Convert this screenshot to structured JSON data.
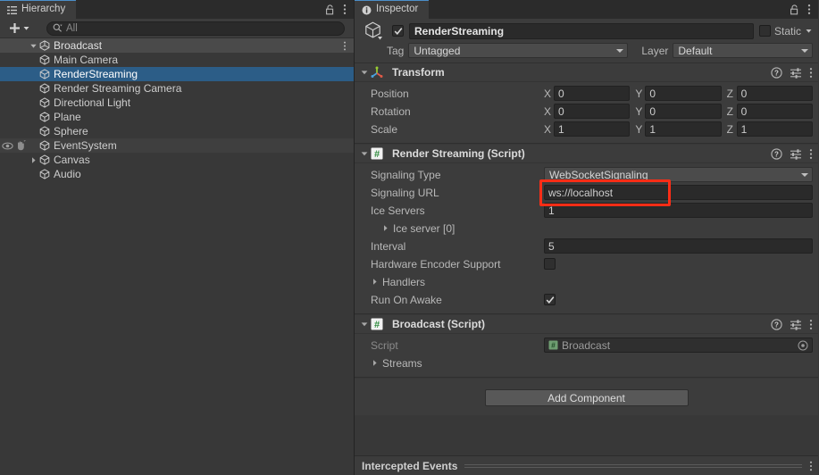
{
  "hierarchy": {
    "tab_label": "Hierarchy",
    "tab_icon": "hierarchy-icon",
    "lock_icon": "lock-open-icon",
    "menu_icon": "kebab-menu-icon",
    "toolbar": {
      "add_label": "+",
      "add_dropdown_icon": "chevron-down-icon",
      "search_icon": "search-icon",
      "search_placeholder": "All",
      "search_value": ""
    },
    "scene_name": "Broadcast",
    "scene_icon": "unity-scene-icon",
    "scene_menu_icon": "kebab-menu-icon",
    "items": [
      {
        "label": "Main Camera",
        "icon": "gameobject-cube-icon",
        "selected": false,
        "expandable": false,
        "visibility_icons": false
      },
      {
        "label": "RenderStreaming",
        "icon": "gameobject-cube-icon",
        "selected": true,
        "expandable": false,
        "visibility_icons": false
      },
      {
        "label": "Render Streaming Camera",
        "icon": "gameobject-cube-icon",
        "selected": false,
        "expandable": false,
        "visibility_icons": false
      },
      {
        "label": "Directional Light",
        "icon": "gameobject-cube-icon",
        "selected": false,
        "expandable": false,
        "visibility_icons": false
      },
      {
        "label": "Plane",
        "icon": "gameobject-cube-icon",
        "selected": false,
        "expandable": false,
        "visibility_icons": false
      },
      {
        "label": "Sphere",
        "icon": "gameobject-cube-icon",
        "selected": false,
        "expandable": false,
        "visibility_icons": false
      },
      {
        "label": "EventSystem",
        "icon": "gameobject-cube-icon",
        "selected": false,
        "expandable": false,
        "visibility_icons": true
      },
      {
        "label": "Canvas",
        "icon": "gameobject-cube-icon",
        "selected": false,
        "expandable": true,
        "visibility_icons": false
      },
      {
        "label": "Audio",
        "icon": "gameobject-cube-icon",
        "selected": false,
        "expandable": false,
        "visibility_icons": false
      }
    ]
  },
  "inspector": {
    "tab_label": "Inspector",
    "tab_icon": "info-icon",
    "lock_icon": "lock-open-icon",
    "menu_icon": "kebab-menu-icon",
    "gameobject": {
      "icon": "gameobject-cube-icon",
      "enabled": true,
      "name": "RenderStreaming",
      "static_label": "Static",
      "static_checked": false,
      "tag_label": "Tag",
      "tag_value": "Untagged",
      "layer_label": "Layer",
      "layer_value": "Default"
    },
    "components": [
      {
        "title": "Transform",
        "icon": "transform-axis-icon",
        "expanded": true,
        "help_icon": "help-icon",
        "preset_icon": "preset-sliders-icon",
        "menu_icon": "kebab-menu-icon",
        "rows": [
          {
            "label": "Position",
            "axes": [
              "X",
              "Y",
              "Z"
            ],
            "values": [
              "0",
              "0",
              "0"
            ]
          },
          {
            "label": "Rotation",
            "axes": [
              "X",
              "Y",
              "Z"
            ],
            "values": [
              "0",
              "0",
              "0"
            ]
          },
          {
            "label": "Scale",
            "axes": [
              "X",
              "Y",
              "Z"
            ],
            "values": [
              "1",
              "1",
              "1"
            ]
          }
        ]
      },
      {
        "title": "Render Streaming (Script)",
        "icon": "cs-script-icon",
        "expanded": true,
        "help_icon": "help-icon",
        "preset_icon": "preset-sliders-icon",
        "menu_icon": "kebab-menu-icon",
        "props": [
          {
            "label": "Signaling Type",
            "kind": "dropdown",
            "value": "WebSocketSignaling"
          },
          {
            "label": "Signaling URL",
            "kind": "text",
            "value": "ws://localhost"
          },
          {
            "label": "Ice Servers",
            "kind": "text",
            "value": "1"
          },
          {
            "label": "Ice server [0]",
            "kind": "foldout2",
            "value": ""
          },
          {
            "label": "Interval",
            "kind": "text",
            "value": "5"
          },
          {
            "label": "Hardware Encoder Support",
            "kind": "checkbox",
            "value": false
          },
          {
            "label": "Handlers",
            "kind": "foldout",
            "value": ""
          },
          {
            "label": "Run On Awake",
            "kind": "checkbox",
            "value": true
          }
        ]
      },
      {
        "title": "Broadcast (Script)",
        "icon": "cs-script-icon",
        "expanded": true,
        "help_icon": "help-icon",
        "preset_icon": "preset-sliders-icon",
        "menu_icon": "kebab-menu-icon",
        "props": [
          {
            "label": "Script",
            "kind": "object",
            "value": "Broadcast"
          },
          {
            "label": "Streams",
            "kind": "foldout",
            "value": ""
          }
        ]
      }
    ],
    "add_component_label": "Add Component",
    "footer": {
      "label": "Intercepted Events",
      "menu_icon": "kebab-menu-icon"
    }
  },
  "annotation": {
    "color": "#ff2d16",
    "target": "signaling-url-field"
  }
}
